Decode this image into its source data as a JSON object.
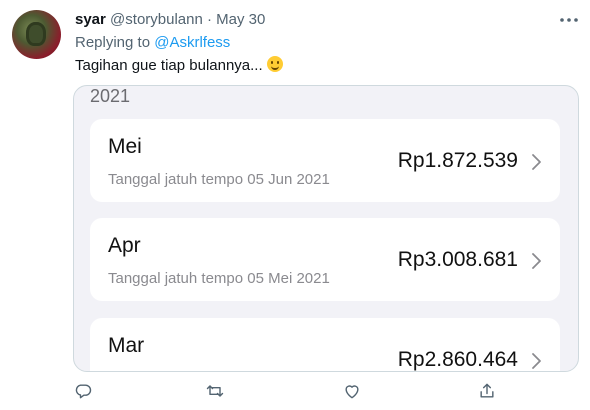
{
  "tweet": {
    "display_name": "syar",
    "handle": "@storybulann",
    "separator": "·",
    "date": "May 30",
    "replying_to_prefix": "Replying to",
    "replying_to_handle": "@Askrlfess",
    "text": "Tagihan gue tiap bulannya...",
    "more_icon": "more-horizontal-icon",
    "emoji": "slightly-smiling-face-emoji"
  },
  "media": {
    "year_label": "2021",
    "bills": [
      {
        "month": "Mei",
        "due": "Tanggal jatuh tempo 05 Jun 2021",
        "amount": "Rp1.872.539"
      },
      {
        "month": "Apr",
        "due": "Tanggal jatuh tempo 05 Mei 2021",
        "amount": "Rp3.008.681"
      },
      {
        "month": "Mar",
        "due": "",
        "amount": "Rp2.860.464"
      }
    ]
  },
  "actions": {
    "icons": [
      "reply-icon",
      "retweet-icon",
      "like-icon",
      "share-icon"
    ],
    "icon_color": "#536471"
  },
  "colors": {
    "link": "#1d9bf0",
    "secondary_text": "#536471",
    "media_background": "#f2f2f7"
  }
}
